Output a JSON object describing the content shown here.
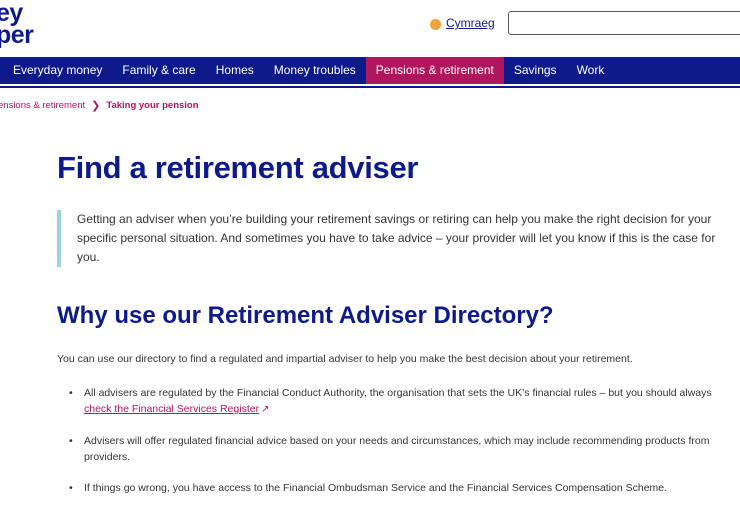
{
  "logo": {
    "line1": "ey",
    "line2": "per"
  },
  "language_link": "Cymraeg",
  "search": {
    "placeholder": ""
  },
  "nav": [
    "Everyday money",
    "Family & care",
    "Homes",
    "Money troubles",
    "Pensions & retirement",
    "Savings",
    "Work"
  ],
  "breadcrumb": {
    "parent": "ensions & retirement",
    "separator": "❯",
    "current": "Taking your pension"
  },
  "page_title": "Find a retirement adviser",
  "callout": "Getting an adviser when you’re building your retirement savings or retiring can help you make the right decision for your specific personal situation. And sometimes you have to take advice – your provider will let you know if this is the case for you.",
  "section_heading": "Why use our Retirement Adviser Directory?",
  "intro": "You can use our directory to find a regulated and impartial adviser to help you make the best decision about your retirement.",
  "bullets": {
    "b1_text": "All advisers are regulated by the Financial Conduct Authority, the organisation that sets the UK’s financial rules – but you should always ",
    "b1_link": "check the Financial Services Register",
    "b2_text": "Advisers will offer regulated financial advice based on your needs and circumstances, which may include recommending products from providers.",
    "b3_text": "If things go wrong, you have access to the Financial Ombudsman Service and the Financial Services Compensation Scheme."
  },
  "colors": {
    "brand_blue": "#0f1a8a",
    "accent_pink": "#b0165e",
    "callout_border": "#9fd4df",
    "lang_dot": "#f4a13a"
  }
}
